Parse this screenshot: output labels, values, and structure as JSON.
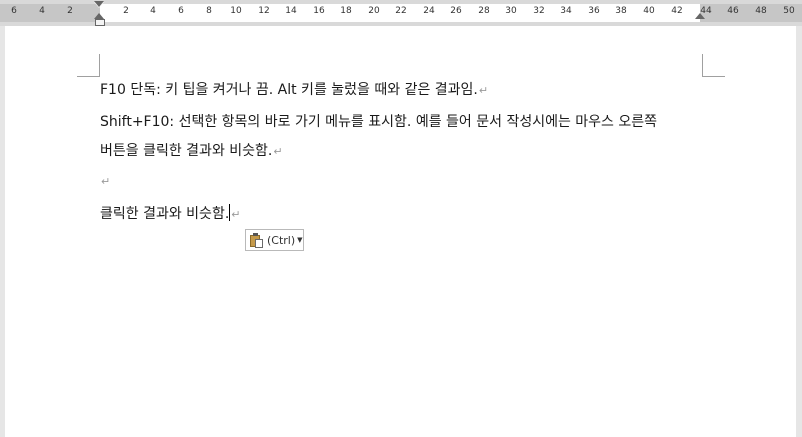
{
  "ruler": {
    "left_ticks": [
      "6",
      "4",
      "2"
    ],
    "main_ticks": [
      "2",
      "4",
      "6",
      "8",
      "10",
      "12",
      "14",
      "16",
      "18",
      "20",
      "22",
      "24",
      "26",
      "28",
      "30",
      "32",
      "34",
      "36",
      "38",
      "40",
      "42"
    ],
    "right_ticks": [
      "44",
      "46",
      "48",
      "50"
    ]
  },
  "document": {
    "para1": "F10 단독: 키 팁을 켜거나 끔. Alt 키를 눌렀을 때와 같은 결과임.",
    "para2_line1": "Shift+F10: 선택한 항목의 바로 가기 메뉴를 표시함.  예를  들어  문서  작성시에는  마우스  오른쪽",
    "para2_line2": "버튼을 클릭한 결과와 비슷함.",
    "para4": "클릭한  결과와  비슷함.",
    "pilcrow": "↵"
  },
  "paste_options": {
    "label": "(Ctrl)",
    "icon": "clipboard-paste-icon"
  }
}
